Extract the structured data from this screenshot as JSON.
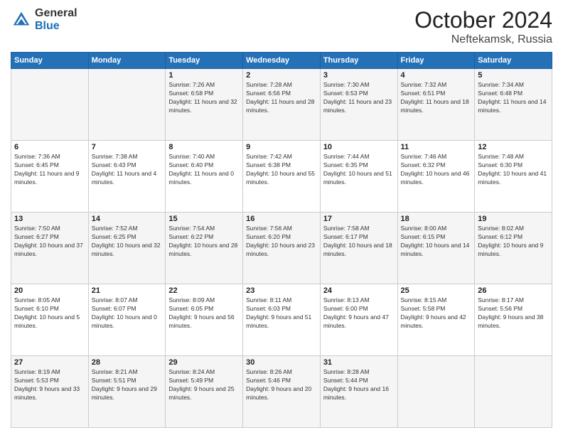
{
  "header": {
    "logo_general": "General",
    "logo_blue": "Blue",
    "month_title": "October 2024",
    "location": "Neftekamsk, Russia"
  },
  "days_of_week": [
    "Sunday",
    "Monday",
    "Tuesday",
    "Wednesday",
    "Thursday",
    "Friday",
    "Saturday"
  ],
  "weeks": [
    [
      {
        "day": "",
        "info": ""
      },
      {
        "day": "",
        "info": ""
      },
      {
        "day": "1",
        "info": "Sunrise: 7:26 AM\nSunset: 6:58 PM\nDaylight: 11 hours and 32 minutes."
      },
      {
        "day": "2",
        "info": "Sunrise: 7:28 AM\nSunset: 6:56 PM\nDaylight: 11 hours and 28 minutes."
      },
      {
        "day": "3",
        "info": "Sunrise: 7:30 AM\nSunset: 6:53 PM\nDaylight: 11 hours and 23 minutes."
      },
      {
        "day": "4",
        "info": "Sunrise: 7:32 AM\nSunset: 6:51 PM\nDaylight: 11 hours and 18 minutes."
      },
      {
        "day": "5",
        "info": "Sunrise: 7:34 AM\nSunset: 6:48 PM\nDaylight: 11 hours and 14 minutes."
      }
    ],
    [
      {
        "day": "6",
        "info": "Sunrise: 7:36 AM\nSunset: 6:45 PM\nDaylight: 11 hours and 9 minutes."
      },
      {
        "day": "7",
        "info": "Sunrise: 7:38 AM\nSunset: 6:43 PM\nDaylight: 11 hours and 4 minutes."
      },
      {
        "day": "8",
        "info": "Sunrise: 7:40 AM\nSunset: 6:40 PM\nDaylight: 11 hours and 0 minutes."
      },
      {
        "day": "9",
        "info": "Sunrise: 7:42 AM\nSunset: 6:38 PM\nDaylight: 10 hours and 55 minutes."
      },
      {
        "day": "10",
        "info": "Sunrise: 7:44 AM\nSunset: 6:35 PM\nDaylight: 10 hours and 51 minutes."
      },
      {
        "day": "11",
        "info": "Sunrise: 7:46 AM\nSunset: 6:32 PM\nDaylight: 10 hours and 46 minutes."
      },
      {
        "day": "12",
        "info": "Sunrise: 7:48 AM\nSunset: 6:30 PM\nDaylight: 10 hours and 41 minutes."
      }
    ],
    [
      {
        "day": "13",
        "info": "Sunrise: 7:50 AM\nSunset: 6:27 PM\nDaylight: 10 hours and 37 minutes."
      },
      {
        "day": "14",
        "info": "Sunrise: 7:52 AM\nSunset: 6:25 PM\nDaylight: 10 hours and 32 minutes."
      },
      {
        "day": "15",
        "info": "Sunrise: 7:54 AM\nSunset: 6:22 PM\nDaylight: 10 hours and 28 minutes."
      },
      {
        "day": "16",
        "info": "Sunrise: 7:56 AM\nSunset: 6:20 PM\nDaylight: 10 hours and 23 minutes."
      },
      {
        "day": "17",
        "info": "Sunrise: 7:58 AM\nSunset: 6:17 PM\nDaylight: 10 hours and 18 minutes."
      },
      {
        "day": "18",
        "info": "Sunrise: 8:00 AM\nSunset: 6:15 PM\nDaylight: 10 hours and 14 minutes."
      },
      {
        "day": "19",
        "info": "Sunrise: 8:02 AM\nSunset: 6:12 PM\nDaylight: 10 hours and 9 minutes."
      }
    ],
    [
      {
        "day": "20",
        "info": "Sunrise: 8:05 AM\nSunset: 6:10 PM\nDaylight: 10 hours and 5 minutes."
      },
      {
        "day": "21",
        "info": "Sunrise: 8:07 AM\nSunset: 6:07 PM\nDaylight: 10 hours and 0 minutes."
      },
      {
        "day": "22",
        "info": "Sunrise: 8:09 AM\nSunset: 6:05 PM\nDaylight: 9 hours and 56 minutes."
      },
      {
        "day": "23",
        "info": "Sunrise: 8:11 AM\nSunset: 6:03 PM\nDaylight: 9 hours and 51 minutes."
      },
      {
        "day": "24",
        "info": "Sunrise: 8:13 AM\nSunset: 6:00 PM\nDaylight: 9 hours and 47 minutes."
      },
      {
        "day": "25",
        "info": "Sunrise: 8:15 AM\nSunset: 5:58 PM\nDaylight: 9 hours and 42 minutes."
      },
      {
        "day": "26",
        "info": "Sunrise: 8:17 AM\nSunset: 5:56 PM\nDaylight: 9 hours and 38 minutes."
      }
    ],
    [
      {
        "day": "27",
        "info": "Sunrise: 8:19 AM\nSunset: 5:53 PM\nDaylight: 9 hours and 33 minutes."
      },
      {
        "day": "28",
        "info": "Sunrise: 8:21 AM\nSunset: 5:51 PM\nDaylight: 9 hours and 29 minutes."
      },
      {
        "day": "29",
        "info": "Sunrise: 8:24 AM\nSunset: 5:49 PM\nDaylight: 9 hours and 25 minutes."
      },
      {
        "day": "30",
        "info": "Sunrise: 8:26 AM\nSunset: 5:46 PM\nDaylight: 9 hours and 20 minutes."
      },
      {
        "day": "31",
        "info": "Sunrise: 8:28 AM\nSunset: 5:44 PM\nDaylight: 9 hours and 16 minutes."
      },
      {
        "day": "",
        "info": ""
      },
      {
        "day": "",
        "info": ""
      }
    ]
  ]
}
